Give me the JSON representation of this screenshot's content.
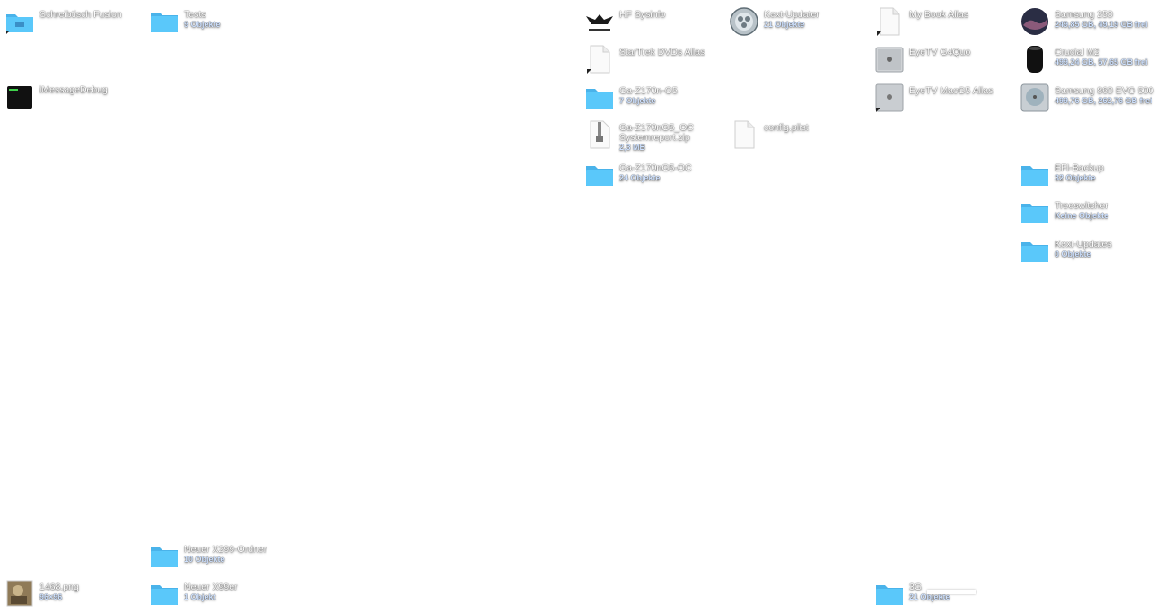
{
  "desktop": {
    "items": [
      {
        "name": "Schreibtisch Fusion",
        "sub": "",
        "icon": "folder-alias-icon"
      },
      {
        "name": "Tests",
        "sub": "9 Objekte",
        "icon": "folder-icon"
      },
      {
        "name": "iMessageDebug",
        "sub": "",
        "icon": "terminal-exec-icon"
      },
      {
        "name": "HF Sysinfo",
        "sub": "",
        "icon": "eagle-logo-icon"
      },
      {
        "name": "Kext-Updater",
        "sub": "21 Objekte",
        "icon": "kext-updater-icon"
      },
      {
        "name": "My Book Alias",
        "sub": "",
        "icon": "alias-document-icon"
      },
      {
        "name": "Samsung 250",
        "sub": "249,85 GB, 49,19 GB frei",
        "icon": "disk-macos-icon"
      },
      {
        "name": "StarTrek DVDs Alias",
        "sub": "",
        "icon": "alias-document-icon"
      },
      {
        "name": "EyeTV G4Quo",
        "sub": "",
        "icon": "mac-server-icon"
      },
      {
        "name": "Crucial M2",
        "sub": "499,24 GB, 57,65 GB frei",
        "icon": "mac-pro-cylinder-icon"
      },
      {
        "name": "Ga-Z170n-G5",
        "sub": "7 Objekte",
        "icon": "folder-icon"
      },
      {
        "name": "EyeTV MacG5 Alias",
        "sub": "",
        "icon": "mac-server-alias-icon"
      },
      {
        "name": "Samsung 860 EVO 500",
        "sub": "499,76 GB, 262,76 GB frei",
        "icon": "hard-disk-icon"
      },
      {
        "name": "Ga-Z170nG5_OC\nSystemreport.zip",
        "sub": "2,3 MB",
        "icon": "zip-icon"
      },
      {
        "name": "config.plist",
        "sub": "",
        "icon": "plist-document-icon"
      },
      {
        "name": "Ga-Z170nG5-OC",
        "sub": "24 Objekte",
        "icon": "folder-icon"
      },
      {
        "name": "EFI-Backup",
        "sub": "32 Objekte",
        "icon": "folder-icon"
      },
      {
        "name": "Treeswitcher",
        "sub": "Keine Objekte",
        "icon": "folder-icon"
      },
      {
        "name": "Kext-Updates",
        "sub": "0 Objekte",
        "icon": "folder-icon"
      },
      {
        "name": "Neuer X299-Ordner",
        "sub": "10 Objekte",
        "icon": "folder-icon"
      },
      {
        "name": "1468.png",
        "sub": "96×96",
        "icon": "image-thumbnail-icon"
      },
      {
        "name": "Neuer X99er",
        "sub": "1 Objekt",
        "icon": "folder-icon"
      },
      {
        "name": "3G",
        "sub": "21 Objekte",
        "icon": "folder-icon"
      }
    ]
  },
  "colors": {
    "folder": "#5ac8fa",
    "folder_tab": "#4ab3ea",
    "label_text": "#ffffff",
    "sub_text": "#cfe2ff"
  }
}
